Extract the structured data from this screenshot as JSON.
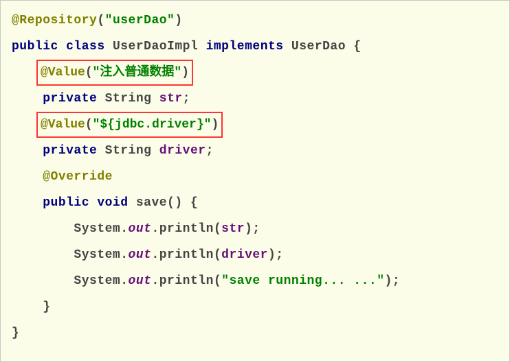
{
  "code": {
    "line1": {
      "annotation": "@Repository",
      "paren_open": "(",
      "string": "\"userDao\"",
      "paren_close": ")"
    },
    "line2": {
      "kw1": "public",
      "kw2": "class",
      "classname": " UserDaoImpl ",
      "kw3": "implements",
      "impl": " UserDao {"
    },
    "line3": {
      "annotation": "@Value",
      "paren_open": "(",
      "string": "\"注入普通数据\"",
      "paren_close": ")"
    },
    "line4": {
      "indent": "    ",
      "kw": "private",
      "type": " String ",
      "field": "str",
      "semi": ";"
    },
    "line5": {
      "annotation": "@Value",
      "paren_open": "(",
      "string": "\"${jdbc.driver}\"",
      "paren_close": ")"
    },
    "line6": {
      "indent": "    ",
      "kw": "private",
      "type": " String ",
      "field": "driver",
      "semi": ";"
    },
    "line7": {
      "indent": "    ",
      "annotation": "@Override"
    },
    "line8": {
      "indent": "    ",
      "kw1": "public",
      "kw2": " void",
      "method": " save() {"
    },
    "line9": {
      "indent": "        ",
      "sys": "System.",
      "out": "out",
      "mid": ".println(",
      "arg": "str",
      "end": ");"
    },
    "line10": {
      "indent": "        ",
      "sys": "System.",
      "out": "out",
      "mid": ".println(",
      "arg": "driver",
      "end": ");"
    },
    "line11": {
      "indent": "        ",
      "sys": "System.",
      "out": "out",
      "mid": ".println(",
      "arg": "\"save running... ...\"",
      "end": ");"
    },
    "line12": {
      "text": "    }"
    },
    "line13": {
      "text": "}"
    }
  }
}
